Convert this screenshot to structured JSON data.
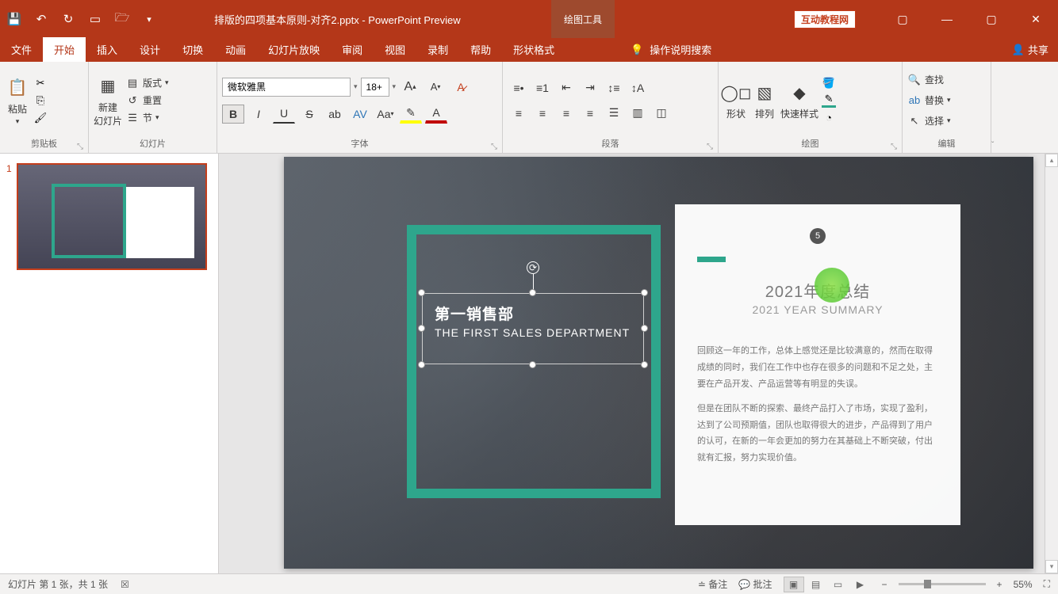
{
  "titlebar": {
    "filename": "排版的四项基本原则-对齐2.pptx  -  PowerPoint Preview",
    "contextual": "绘图工具",
    "badge": "互动教程网"
  },
  "tabs": {
    "file": "文件",
    "home": "开始",
    "insert": "插入",
    "design": "设计",
    "transition": "切换",
    "animation": "动画",
    "slideshow": "幻灯片放映",
    "review": "审阅",
    "view": "视图",
    "record": "录制",
    "help": "帮助",
    "format": "形状格式",
    "tell_me": "操作说明搜索",
    "share": "共享"
  },
  "ribbon": {
    "clipboard": {
      "paste": "粘贴",
      "label": "剪贴板"
    },
    "slides": {
      "new": "新建\n幻灯片",
      "layout": "版式",
      "reset": "重置",
      "section": "节",
      "label": "幻灯片"
    },
    "font": {
      "name": "微软雅黑",
      "size": "18+",
      "label": "字体"
    },
    "paragraph": {
      "label": "段落"
    },
    "drawing": {
      "shapes": "形状",
      "arrange": "排列",
      "quickstyle": "快速样式",
      "label": "绘图"
    },
    "editing": {
      "find": "查找",
      "replace": "替换",
      "select": "选择",
      "label": "编辑"
    }
  },
  "thumbnails": {
    "num1": "1"
  },
  "slide": {
    "h1": "第一销售部",
    "h2": "THE FIRST SALES DEPARTMENT",
    "card_title": "2021年度总结",
    "card_sub": "2021 YEAR SUMMARY",
    "card_num": "5",
    "para1": "回顾这一年的工作，总体上感觉还是比较满意的，然而在取得成绩的同时，我们在工作中也存在很多的问题和不足之处，主要在产品开发、产品运营等有明显的失误。",
    "para2": "但是在团队不断的探索、最终产品打入了市场，实现了盈利，达到了公司预期值，团队也取得很大的进步，产品得到了用户的认可，在新的一年会更加的努力在其基础上不断突破，付出就有汇报，努力实现价值。"
  },
  "statusbar": {
    "slide_info": "幻灯片 第 1 张，共 1 张",
    "notes": "备注",
    "comments": "批注",
    "zoom": "55%"
  }
}
